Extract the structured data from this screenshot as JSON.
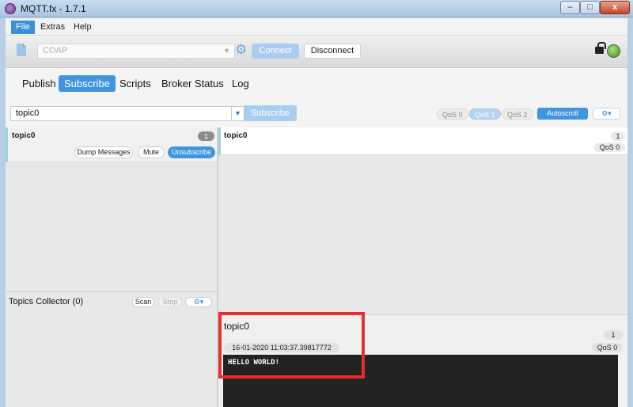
{
  "window": {
    "title": "MQTT.fx - 1.7.1",
    "min_label": "–",
    "max_label": "□",
    "close_label": "x"
  },
  "menu": {
    "file": "File",
    "extras": "Extras",
    "help": "Help"
  },
  "toolbar": {
    "profile": "COAP",
    "connect_label": "Connect",
    "disconnect_label": "Disconnect",
    "connection_status_color": "#4a8f2a"
  },
  "tabs": [
    {
      "label": "Publish"
    },
    {
      "label": "Subscribe",
      "active": true
    },
    {
      "label": "Scripts"
    },
    {
      "label": "Broker Status"
    },
    {
      "label": "Log"
    }
  ],
  "subscribe_bar": {
    "topic_value": "topic0",
    "subscribe_label": "Subscribe",
    "qos0": "QoS 0",
    "qos1": "QoS 1",
    "qos2": "QoS 2",
    "selected_qos": "QoS 1",
    "autoscroll_label": "Autoscroll",
    "options_icon": "gear-dropdown-icon"
  },
  "subscriptions": [
    {
      "topic": "topic0",
      "count": "1",
      "dump_label": "Dump Messages",
      "mute_label": "Mute",
      "unsubscribe_label": "Unsubscribe"
    }
  ],
  "collector": {
    "title": "Topics Collector (0)",
    "scan_label": "Scan",
    "stop_label": "Stop"
  },
  "messages": [
    {
      "topic": "topic0",
      "index": "1",
      "qos": "QoS 0"
    }
  ],
  "detail": {
    "topic": "topic0",
    "index": "1",
    "timestamp": "16-01-2020  11:03:37.39817772",
    "qos": "QoS 0",
    "payload": "HELLO WORLD!"
  },
  "colors": {
    "accent": "#3f95e0",
    "highlight": "#e3302b"
  }
}
